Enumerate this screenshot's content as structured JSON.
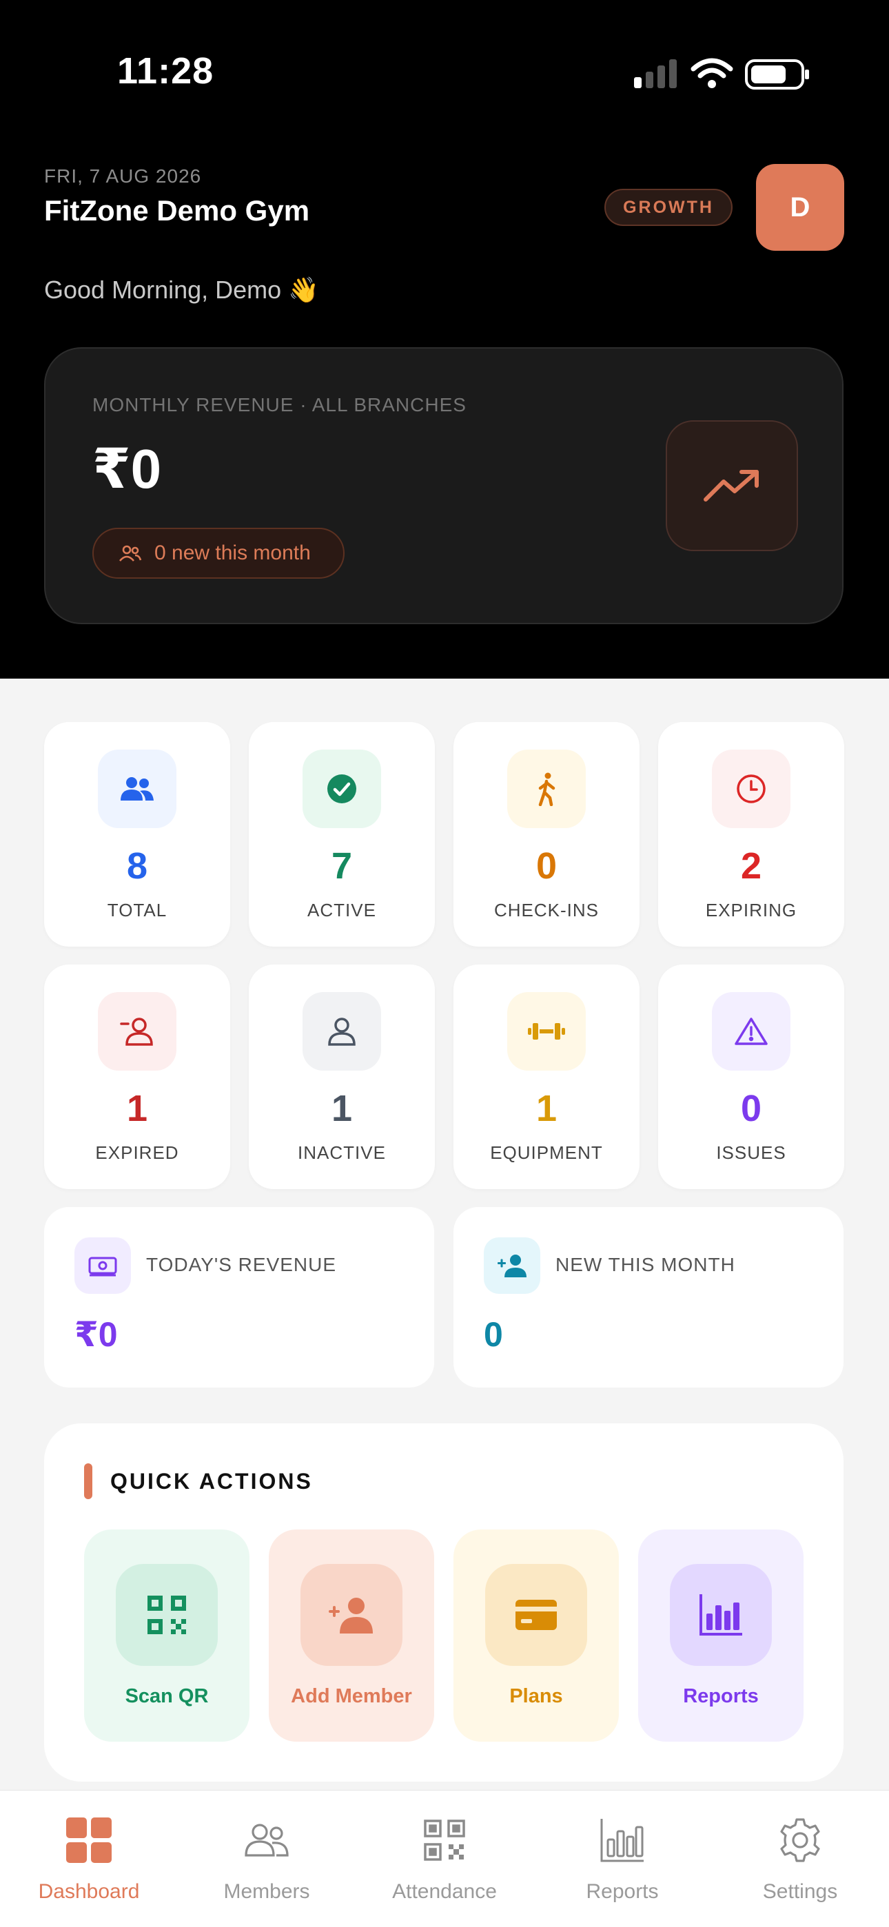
{
  "status_bar": {
    "time": "11:28"
  },
  "header": {
    "date": "FRI, 7 AUG 2026",
    "gym_name": "FitZone Demo Gym",
    "plan_badge": "GROWTH",
    "avatar_initial": "D",
    "greeting": "Good Morning, Demo 👋"
  },
  "revenue_card": {
    "label": "MONTHLY REVENUE · ALL BRANCHES",
    "amount": "₹0",
    "new_this_month": "0 new this month"
  },
  "stats": [
    {
      "value": "8",
      "label": "TOTAL",
      "icon": "members-icon",
      "color": "#2563eb",
      "bg": "#eef4ff"
    },
    {
      "value": "7",
      "label": "ACTIVE",
      "icon": "check-circle-icon",
      "color": "#15895f",
      "bg": "#e8f8ef"
    },
    {
      "value": "0",
      "label": "CHECK-INS",
      "icon": "walking-icon",
      "color": "#d97706",
      "bg": "#fff8e6"
    },
    {
      "value": "2",
      "label": "EXPIRING",
      "icon": "clock-icon",
      "color": "#dc2626",
      "bg": "#fdf0f0"
    },
    {
      "value": "1",
      "label": "EXPIRED",
      "icon": "user-minus-icon",
      "color": "#c62828",
      "bg": "#fdeeee"
    },
    {
      "value": "1",
      "label": "INACTIVE",
      "icon": "user-icon",
      "color": "#4b5563",
      "bg": "#f1f2f4"
    },
    {
      "value": "1",
      "label": "EQUIPMENT",
      "icon": "dumbbell-icon",
      "color": "#d99a08",
      "bg": "#fff8e6"
    },
    {
      "value": "0",
      "label": "ISSUES",
      "icon": "warning-icon",
      "color": "#7c3aed",
      "bg": "#f3efff"
    }
  ],
  "summary": [
    {
      "label": "TODAY'S REVENUE",
      "value": "₹0",
      "icon": "cash-icon",
      "color": "#7c3aed",
      "bg": "#f1ecff"
    },
    {
      "label": "NEW THIS MONTH",
      "value": "0",
      "icon": "add-user-icon",
      "color": "#0e87a6",
      "bg": "#e4f6fb"
    }
  ],
  "quick_actions": {
    "title": "QUICK ACTIONS",
    "items": [
      {
        "label": "Scan QR",
        "icon": "qr-code-icon",
        "color": "#14905e",
        "bg": "#ebf9f2",
        "icon_bg": "#d3f0e2"
      },
      {
        "label": "Add Member",
        "icon": "add-user-icon",
        "color": "#df7a59",
        "bg": "#fdebe4",
        "icon_bg": "#f9d6c8"
      },
      {
        "label": "Plans",
        "icon": "card-icon",
        "color": "#d98c06",
        "bg": "#fff8e6",
        "icon_bg": "#fbe8c4"
      },
      {
        "label": "Reports",
        "icon": "bar-chart-icon",
        "color": "#7c3aed",
        "bg": "#f3efff",
        "icon_bg": "#e3d8ff"
      }
    ]
  },
  "nav": {
    "items": [
      {
        "label": "Dashboard",
        "icon": "grid-icon",
        "active": true
      },
      {
        "label": "Members",
        "icon": "members-icon",
        "active": false
      },
      {
        "label": "Attendance",
        "icon": "qr-code-icon",
        "active": false
      },
      {
        "label": "Reports",
        "icon": "bar-chart-icon",
        "active": false
      },
      {
        "label": "Settings",
        "icon": "gear-icon",
        "active": false
      }
    ],
    "active_color": "#df7a59"
  }
}
